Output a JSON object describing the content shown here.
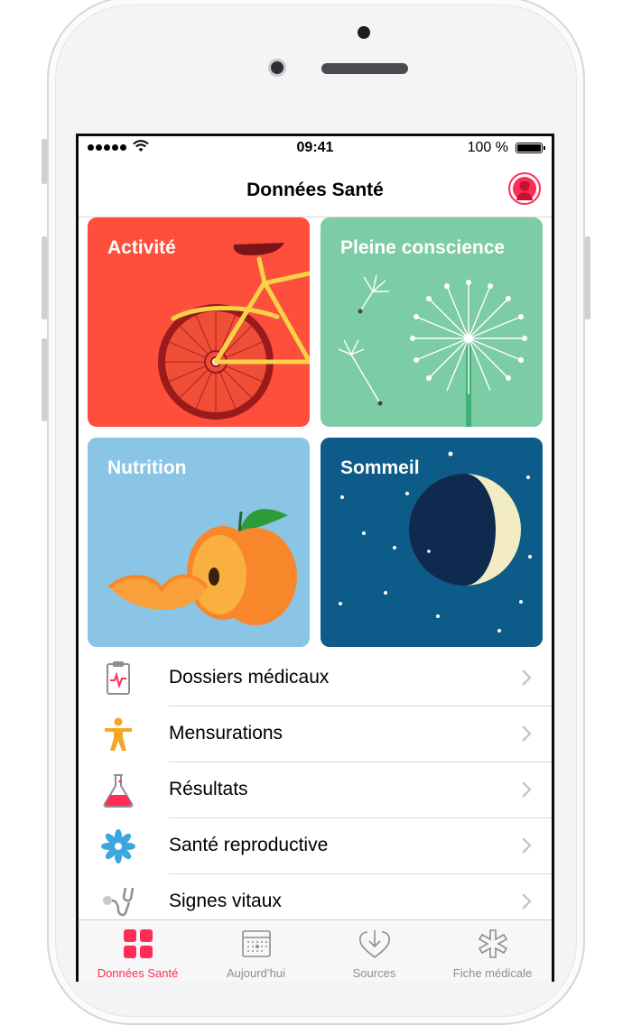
{
  "status_bar": {
    "time": "09:41",
    "battery": "100 %"
  },
  "header": {
    "title": "Données Santé"
  },
  "tiles": [
    {
      "label": "Activité",
      "color": "#fd4f3b"
    },
    {
      "label": "Pleine conscience",
      "color": "#7ccca5"
    },
    {
      "label": "Nutrition",
      "color": "#8ac5e6"
    },
    {
      "label": "Sommeil",
      "color": "#0d5b88"
    }
  ],
  "list": [
    {
      "label": "Dossiers médicaux",
      "icon": "clipboard-heartbeat-icon"
    },
    {
      "label": "Mensurations",
      "icon": "person-body-icon"
    },
    {
      "label": "Résultats",
      "icon": "flask-icon"
    },
    {
      "label": "Santé reproductive",
      "icon": "flower-icon"
    },
    {
      "label": "Signes vitaux",
      "icon": "stethoscope-icon"
    }
  ],
  "tabbar": {
    "items": [
      {
        "label": "Données Santé",
        "icon": "grid-icon",
        "active": true
      },
      {
        "label": "Aujourd’hui",
        "icon": "calendar-icon",
        "active": false
      },
      {
        "label": "Sources",
        "icon": "heart-download-icon",
        "active": false
      },
      {
        "label": "Fiche médicale",
        "icon": "medical-star-icon",
        "active": false
      }
    ]
  },
  "colors": {
    "accent": "#ff2d55"
  }
}
